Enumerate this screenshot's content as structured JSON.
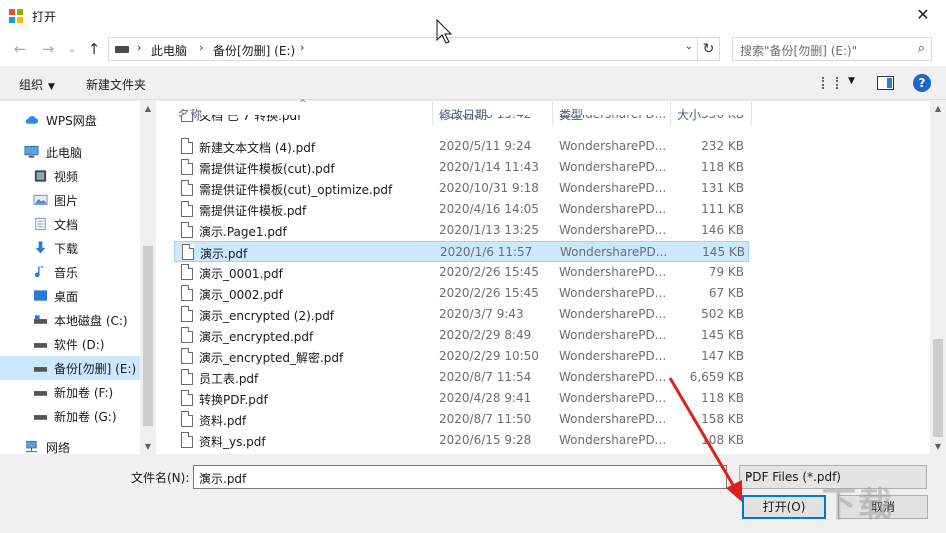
{
  "window": {
    "title": "打开",
    "close_glyph": "✕"
  },
  "nav": {
    "back": "←",
    "forward": "→",
    "recent": "⌄",
    "up": "↑",
    "breadcrumb": [
      "此电脑",
      "备份[勿删] (E:)"
    ],
    "search_placeholder": "搜索\"备份[勿删] (E:)\""
  },
  "toolbar": {
    "organize": "组织",
    "new_folder": "新建文件夹",
    "help": "?"
  },
  "sidebar": {
    "items": [
      {
        "label": "WPS网盘",
        "icon": "cloud-icon"
      },
      {
        "label": "此电脑",
        "icon": "computer-icon"
      },
      {
        "label": "视频",
        "icon": "video-icon"
      },
      {
        "label": "图片",
        "icon": "picture-icon"
      },
      {
        "label": "文档",
        "icon": "document-icon"
      },
      {
        "label": "下载",
        "icon": "download-icon"
      },
      {
        "label": "音乐",
        "icon": "music-icon"
      },
      {
        "label": "桌面",
        "icon": "desktop-icon"
      },
      {
        "label": "本地磁盘 (C:)",
        "icon": "drive-icon"
      },
      {
        "label": "软件 (D:)",
        "icon": "drive-icon"
      },
      {
        "label": "备份[勿删] (E:)",
        "icon": "drive-icon"
      },
      {
        "label": "新加卷 (F:)",
        "icon": "drive-icon"
      },
      {
        "label": "新加卷 (G:)",
        "icon": "drive-icon"
      },
      {
        "label": "网络",
        "icon": "network-icon"
      }
    ]
  },
  "columns": {
    "name": "名称",
    "date": "修改日期",
    "type": "类型",
    "size": "大小"
  },
  "files": [
    {
      "name": "文档 已 7 转换.pdf",
      "date": "2020/8/6 15:42",
      "type": "WondersharePD...",
      "size": "556 KB"
    },
    {
      "name": "新建文本文档 (4).pdf",
      "date": "2020/5/11 9:24",
      "type": "WondersharePD...",
      "size": "232 KB"
    },
    {
      "name": "需提供证件模板(cut).pdf",
      "date": "2020/1/14 11:43",
      "type": "WondersharePD...",
      "size": "118 KB"
    },
    {
      "name": "需提供证件模板(cut)_optimize.pdf",
      "date": "2020/10/31 9:18",
      "type": "WondersharePD...",
      "size": "131 KB"
    },
    {
      "name": "需提供证件模板.pdf",
      "date": "2020/4/16 14:05",
      "type": "WondersharePD...",
      "size": "111 KB"
    },
    {
      "name": "演示.Page1.pdf",
      "date": "2020/1/13 13:25",
      "type": "WondersharePD...",
      "size": "146 KB"
    },
    {
      "name": "演示.pdf",
      "date": "2020/1/6 11:57",
      "type": "WondersharePD...",
      "size": "145 KB"
    },
    {
      "name": "演示_0001.pdf",
      "date": "2020/2/26 15:45",
      "type": "WondersharePD...",
      "size": "79 KB"
    },
    {
      "name": "演示_0002.pdf",
      "date": "2020/2/26 15:45",
      "type": "WondersharePD...",
      "size": "67 KB"
    },
    {
      "name": "演示_encrypted (2).pdf",
      "date": "2020/3/7 9:43",
      "type": "WondersharePD...",
      "size": "502 KB"
    },
    {
      "name": "演示_encrypted.pdf",
      "date": "2020/2/29 8:49",
      "type": "WondersharePD...",
      "size": "145 KB"
    },
    {
      "name": "演示_encrypted_解密.pdf",
      "date": "2020/2/29 10:50",
      "type": "WondersharePD...",
      "size": "147 KB"
    },
    {
      "name": "员工表.pdf",
      "date": "2020/8/7 11:54",
      "type": "WondersharePD...",
      "size": "6,659 KB"
    },
    {
      "name": "转换PDF.pdf",
      "date": "2020/4/28 9:41",
      "type": "WondersharePD...",
      "size": "118 KB"
    },
    {
      "name": "资料.pdf",
      "date": "2020/8/7 11:50",
      "type": "WondersharePD...",
      "size": "158 KB"
    },
    {
      "name": "资料_ys.pdf",
      "date": "2020/6/15 9:28",
      "type": "WondersharePD...",
      "size": "108 KB"
    }
  ],
  "bottom": {
    "filename_label": "文件名(N):",
    "filename_value": "演示.pdf",
    "filetype_value": "PDF Files (*.pdf)",
    "open_label": "打开(O)",
    "cancel_label": "取消"
  },
  "colors": {
    "selection": "#cce8ff",
    "accent": "#0078d7",
    "annotation_arrow": "#e0201b"
  }
}
